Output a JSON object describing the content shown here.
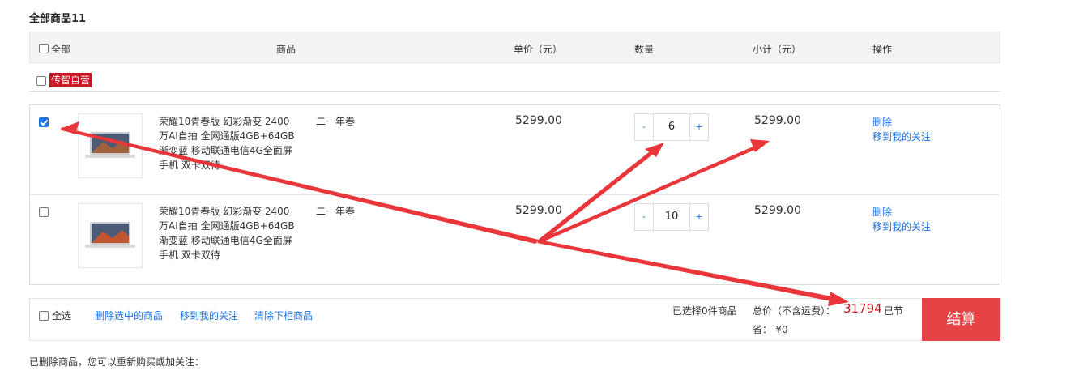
{
  "page_title": "全部商品11",
  "header": {
    "select_all": "全部",
    "product": "商品",
    "unit_price": "单价（元）",
    "quantity": "数量",
    "subtotal": "小计（元）",
    "actions": "操作"
  },
  "shop": {
    "name": "传智自营"
  },
  "items": [
    {
      "checked": true,
      "name": "荣耀10青春版 幻彩渐变 2400万AI自拍 全网通版4GB+64GB 渐变蓝 移动联通电信4G全面屏手机 双卡双待",
      "spec": "二一年春",
      "price": "5299.00",
      "quantity": "6",
      "subtotal": "5299.00",
      "action_delete": "删除",
      "action_follow": "移到我的关注"
    },
    {
      "checked": false,
      "name": "荣耀10青春版 幻彩渐变 2400万AI自拍 全网通版4GB+64GB 渐变蓝 移动联通电信4G全面屏手机 双卡双待",
      "spec": "二一年春",
      "price": "5299.00",
      "quantity": "10",
      "subtotal": "5299.00",
      "action_delete": "删除",
      "action_follow": "移到我的关注"
    }
  ],
  "qty_minus": "-",
  "qty_plus": "+",
  "footer": {
    "select_all": "全选",
    "delete_selected": "删除选中的商品",
    "move_to_follow": "移到我的关注",
    "clear_removed": "清除下柜商品",
    "selected_count": "已选择0件商品",
    "total_label": "总价（不含运费）：",
    "total_value": "31794",
    "saved_label_1": "已节",
    "saved_label_2": "省：-¥0",
    "checkout": "结算"
  },
  "deleted_notice": "已删除商品，您可以重新购买或加关注：",
  "colors": {
    "accent_blue": "#1a73e8",
    "brand_red": "#c81623",
    "checkout_red": "#e54346",
    "annotation_red": "#e8363a"
  }
}
